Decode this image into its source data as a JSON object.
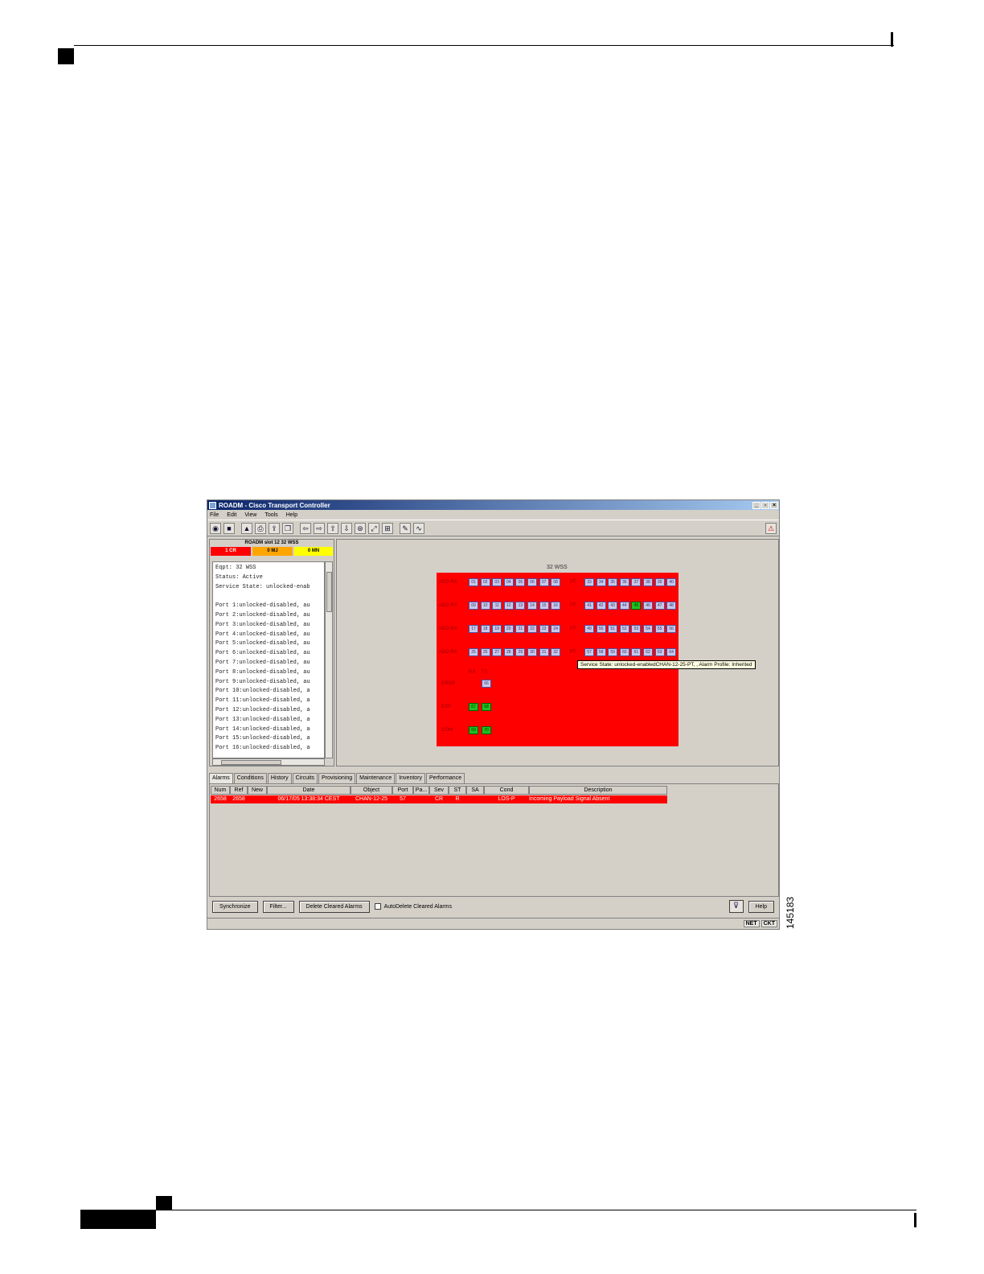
{
  "figure": {
    "id": "145183"
  },
  "window": {
    "title": "ROADM - Cisco Transport Controller",
    "menu": [
      "File",
      "Edit",
      "View",
      "Tools",
      "Help"
    ]
  },
  "card_view": {
    "title": "ROADM slot 12 32 WSS",
    "counts": {
      "critical": "1 CR",
      "major": "0 MJ",
      "minor": "0 MN"
    },
    "info_lines": [
      "Eqpt: 32 WSS",
      "Status: Active",
      "Service State: unlocked-enab",
      "",
      "Port 1:unlocked-disabled, au",
      "Port 2:unlocked-disabled, au",
      "Port 3:unlocked-disabled, au",
      "Port 4:unlocked-disabled, au",
      "Port 5:unlocked-disabled, au",
      "Port 6:unlocked-disabled, au",
      "Port 7:unlocked-disabled, au",
      "Port 8:unlocked-disabled, au",
      "Port 9:unlocked-disabled, au",
      "Port 10:unlocked-disabled, a",
      "Port 11:unlocked-disabled, a",
      "Port 12:unlocked-disabled, a",
      "Port 13:unlocked-disabled, a",
      "Port 14:unlocked-disabled, a",
      "Port 15:unlocked-disabled, a",
      "Port 16:unlocked-disabled, a"
    ]
  },
  "card_graphic": {
    "name": "32 WSS",
    "rows": [
      {
        "left_label": "ADD RX",
        "left_ports": [
          "01",
          "02",
          "03",
          "04",
          "05",
          "06",
          "07",
          "08"
        ],
        "right_label": "PT",
        "right_ports": [
          "33",
          "34",
          "35",
          "36",
          "37",
          "38",
          "39",
          "40"
        ]
      },
      {
        "left_label": "ADD RX",
        "left_ports": [
          "09",
          "10",
          "11",
          "12",
          "13",
          "14",
          "15",
          "16"
        ],
        "right_label": "PT",
        "right_ports": [
          "41",
          "42",
          "43",
          "44",
          "45",
          "46",
          "47",
          "48"
        ]
      },
      {
        "left_label": "ADD RX",
        "left_ports": [
          "17",
          "18",
          "19",
          "20",
          "21",
          "22",
          "23",
          "24"
        ],
        "right_label": "PT",
        "right_ports": [
          "49",
          "50",
          "51",
          "52",
          "53",
          "54",
          "55",
          "56"
        ]
      },
      {
        "left_label": "ADD RX",
        "left_ports": [
          "25",
          "26",
          "27",
          "28",
          "29",
          "30",
          "31",
          "32"
        ],
        "right_label": "PT",
        "right_ports": [
          "57",
          "58",
          "59",
          "60",
          "61",
          "62",
          "63",
          "64"
        ]
      }
    ],
    "highlighted_port": "45",
    "rx_tx_labels": [
      "RX",
      "TX"
    ],
    "bottom_rows": [
      {
        "label": "DROP",
        "ports": [
          "",
          "66"
        ],
        "colors": [
          "none",
          "blue"
        ]
      },
      {
        "label": "EXP",
        "ports": [
          "67",
          "68"
        ],
        "colors": [
          "green",
          "green"
        ]
      },
      {
        "label": "COM",
        "ports": [
          "69",
          "70"
        ],
        "colors": [
          "green",
          "green"
        ]
      }
    ],
    "tooltip": "Service State: unlocked-enabledCHAN-12-25-PT, , Alarm Profile: Inherited"
  },
  "tabs": [
    "Alarms",
    "Conditions",
    "History",
    "Circuits",
    "Provisioning",
    "Maintenance",
    "Inventory",
    "Performance"
  ],
  "alarm_table": {
    "columns": [
      "Num",
      "Ref",
      "New",
      "Date",
      "Object",
      "Port",
      "Pa...",
      "Sev",
      "ST",
      "SA",
      "Cond",
      "Description"
    ],
    "rows": [
      [
        "2658",
        "2658",
        "",
        "06/17/05 13:38:34 CEST",
        "CHAN-12-25",
        "57",
        "",
        "CR",
        "R",
        "",
        "LOS-P",
        "Incoming Payload Signal Absent"
      ]
    ]
  },
  "buttons": {
    "synchronize": "Synchronize",
    "filter": "Filter...",
    "delete_cleared": "Delete Cleared Alarms",
    "autodelete": "AutoDelete Cleared Alarms",
    "help": "Help"
  },
  "status": [
    "NET",
    "CKT"
  ]
}
